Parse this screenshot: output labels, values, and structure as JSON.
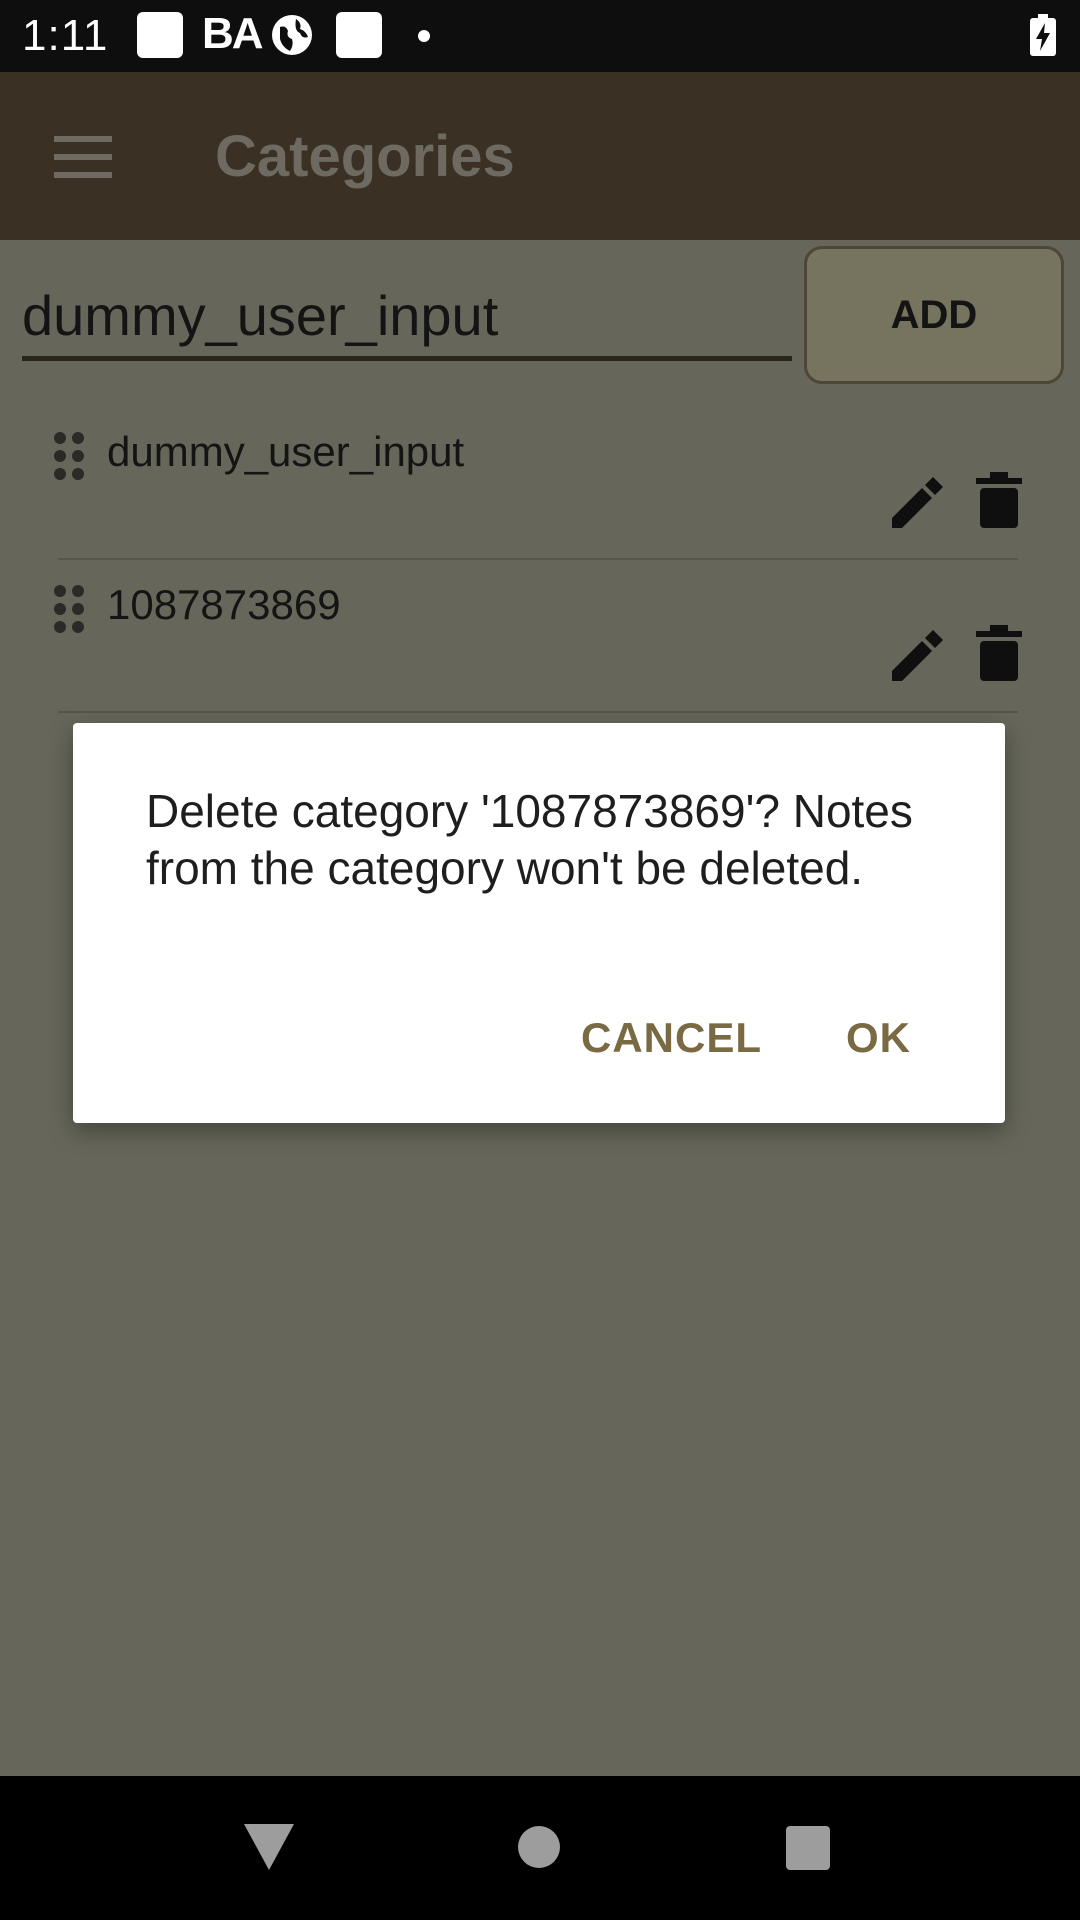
{
  "status_bar": {
    "time": "1:11",
    "icons": [
      "square-notification-icon",
      "ba-icon",
      "globe-icon",
      "square-notification-icon",
      "dot-icon",
      "battery-charging-icon"
    ],
    "ba_label": "BA"
  },
  "app_bar": {
    "title": "Categories",
    "menu_icon": "hamburger-menu-icon"
  },
  "add_category": {
    "input_value": "dummy_user_input",
    "button_label": "ADD"
  },
  "categories": [
    {
      "label": "dummy_user_input"
    },
    {
      "label": "1087873869"
    }
  ],
  "dialog": {
    "message": "Delete category '1087873869'? Notes from the category won't be deleted.",
    "cancel_label": "CANCEL",
    "ok_label": "OK"
  },
  "nav_bar": {
    "icons": [
      "back-icon",
      "home-icon",
      "recents-icon"
    ]
  },
  "colors": {
    "app_bar": "#3a3124",
    "content_bg": "#66675a",
    "dialog_accent": "#7a6a43",
    "status_bar": "#0e0e0e"
  }
}
